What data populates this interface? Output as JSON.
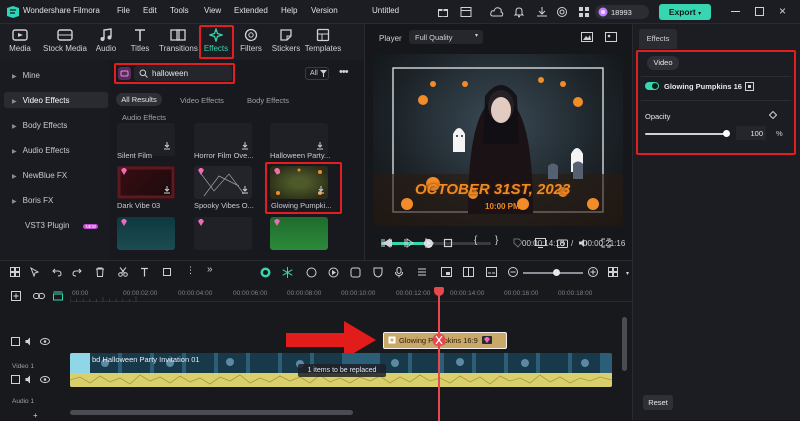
{
  "app": {
    "name": "Wondershare Filmora",
    "menu": [
      "File",
      "Edit",
      "Tools",
      "View",
      "Extended",
      "Help",
      "Version"
    ],
    "project": "Untitled",
    "credits": "18993",
    "export_label": "Export"
  },
  "toolbar": {
    "tabs": [
      "Media",
      "Stock Media",
      "Audio",
      "Titles",
      "Transitions",
      "Effects",
      "Filters",
      "Stickers",
      "Templates"
    ],
    "active": "Effects"
  },
  "leftnav": {
    "items": [
      "Mine",
      "Video Effects",
      "Body Effects",
      "Audio Effects",
      "NewBlue FX",
      "Boris FX",
      "VST3 Plugin"
    ],
    "active": "Video Effects",
    "vst_badge": "NEW"
  },
  "search": {
    "value": "halloween",
    "filter": "All"
  },
  "browser": {
    "subtabs": [
      "All Results",
      "Video Effects",
      "Body Effects"
    ],
    "active_subtab": "All Results",
    "section": "Audio Effects",
    "items": [
      {
        "label": "Silent Film"
      },
      {
        "label": "Horror Film Ove..."
      },
      {
        "label": "Halloween Party..."
      },
      {
        "label": "Dark Vibe 03"
      },
      {
        "label": "Spooky Vibes O..."
      },
      {
        "label": "Glowing Pumpki..."
      },
      {
        "label": ""
      },
      {
        "label": ""
      },
      {
        "label": ""
      }
    ]
  },
  "player": {
    "label": "Player",
    "quality": "Full Quality",
    "overlay_text": "OCTOBER 31ST, 2023",
    "overlay_sub": "10:00 PM",
    "current": "00:00:14:18",
    "separator": "/",
    "total": "00:00:21:16",
    "progress": 0.43
  },
  "rightpanel": {
    "tab": "Effects",
    "subtab": "Video",
    "effect_name": "Glowing Pumpkins 16",
    "opacity_label": "Opacity",
    "opacity_value": "100",
    "opacity_unit": "%",
    "reset_label": "Reset"
  },
  "timeline": {
    "ruler": [
      "00:00",
      "00:00:02:00",
      "00:00:04:00",
      "00:00:06:00",
      "00:00:08:00",
      "00:00:10:00",
      "00:00:12:00",
      "00:00:14:00",
      "00:00:16:00",
      "00:00:18:00",
      "00:00:20:00"
    ],
    "effect_clip": "Glowing Pumpkins 16:9",
    "video_clip": "bd Halloween Party Invitation 01",
    "replace_note": "1 items to be replaced",
    "track_video": "Video 1",
    "track_audio": "Audio 1"
  },
  "colors": {
    "accent": "#36d6b0",
    "red": "#e02020",
    "clip": "#c9a86a",
    "text": "#d4d6dc"
  }
}
